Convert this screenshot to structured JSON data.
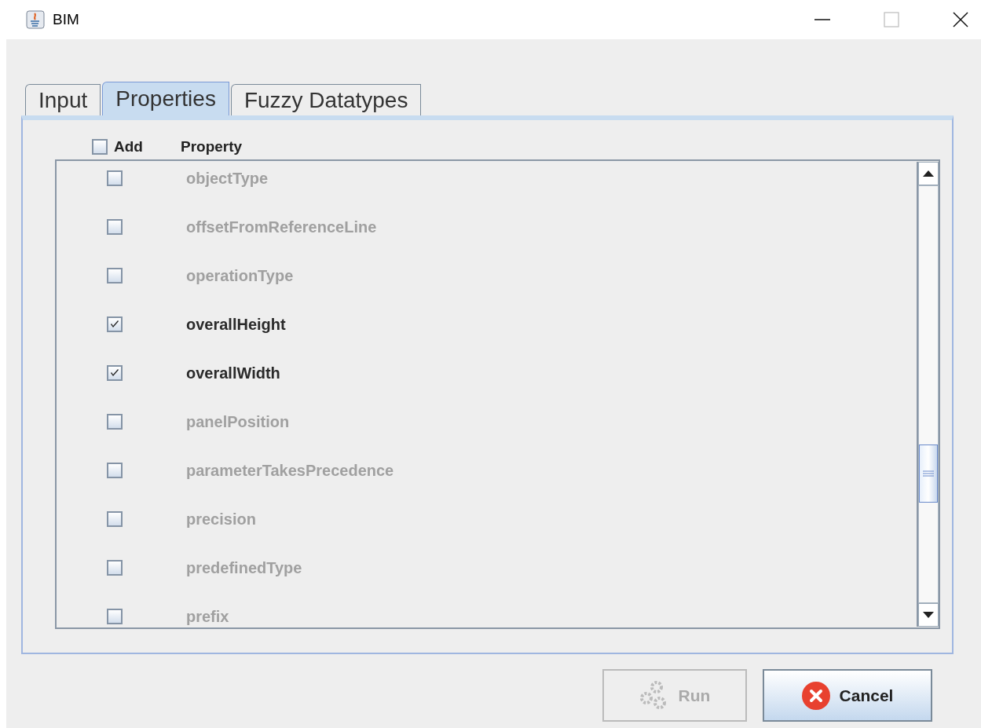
{
  "window": {
    "title": "BIM"
  },
  "tabs": [
    {
      "label": "Input",
      "selected": false
    },
    {
      "label": "Properties",
      "selected": true
    },
    {
      "label": "Fuzzy Datatypes",
      "selected": false
    }
  ],
  "table": {
    "header": {
      "select_all_checked": false,
      "add_label": "Add",
      "property_label": "Property"
    },
    "rows": [
      {
        "name": "objectType",
        "checked": false
      },
      {
        "name": "offsetFromReferenceLine",
        "checked": false
      },
      {
        "name": "operationType",
        "checked": false
      },
      {
        "name": "overallHeight",
        "checked": true
      },
      {
        "name": "overallWidth",
        "checked": true
      },
      {
        "name": "panelPosition",
        "checked": false
      },
      {
        "name": "parameterTakesPrecedence",
        "checked": false
      },
      {
        "name": "precision",
        "checked": false
      },
      {
        "name": "predefinedType",
        "checked": false
      },
      {
        "name": "prefix",
        "checked": false
      }
    ]
  },
  "buttons": [
    {
      "kind": "run",
      "label": "Run",
      "disabled": true
    },
    {
      "kind": "cancel",
      "label": "Cancel",
      "disabled": false
    }
  ]
}
